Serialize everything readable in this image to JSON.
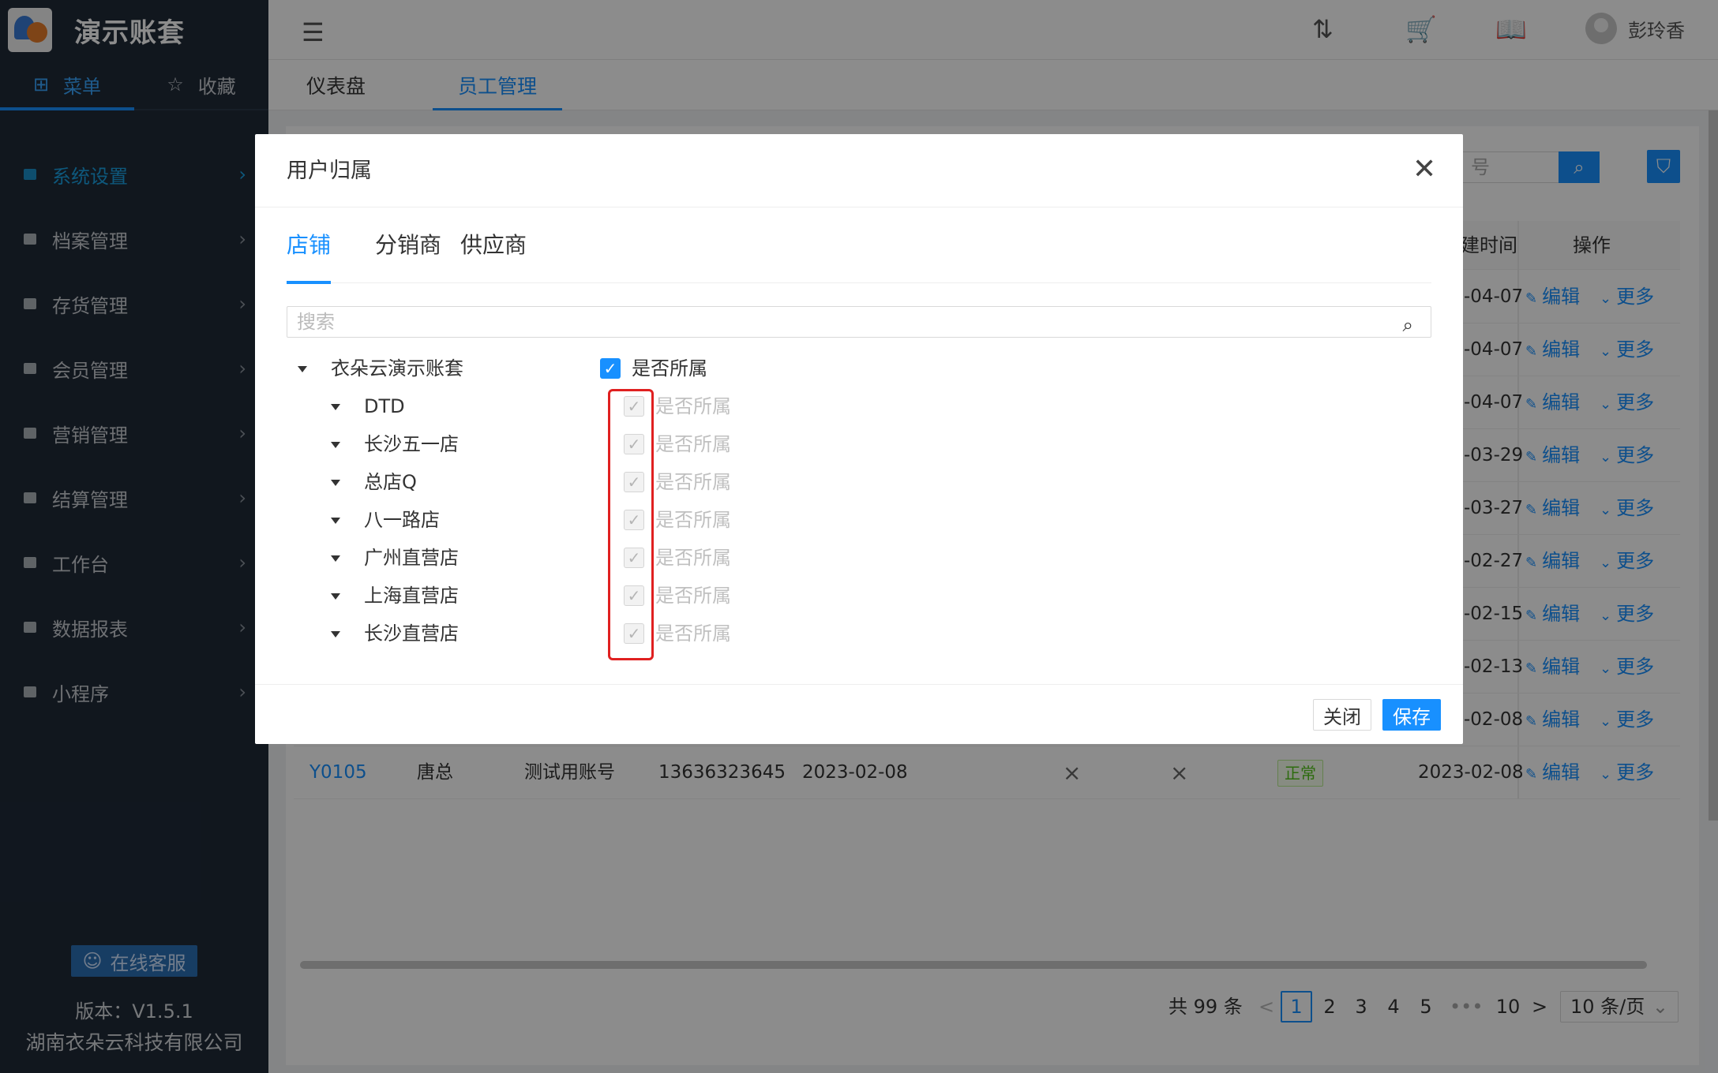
{
  "app": {
    "brand_title": "演示账套",
    "side_tabs": [
      {
        "label": "菜单",
        "icon": "grid-icon"
      },
      {
        "label": "收藏",
        "icon": "star-icon"
      }
    ],
    "menu": [
      {
        "label": "系统设置",
        "active": true
      },
      {
        "label": "档案管理"
      },
      {
        "label": "存货管理"
      },
      {
        "label": "会员管理"
      },
      {
        "label": "营销管理"
      },
      {
        "label": "结算管理"
      },
      {
        "label": "工作台"
      },
      {
        "label": "数据报表"
      },
      {
        "label": "小程序"
      }
    ],
    "support_label": "在线客服",
    "version": "版本：V1.5.1",
    "company": "湖南衣朵云科技有限公司"
  },
  "header": {
    "user_name": "彭玲香",
    "icons": [
      "menu-toggle-icon",
      "sort-az-icon",
      "cart-icon",
      "book-icon"
    ]
  },
  "page_tabs": [
    {
      "label": "仪表盘"
    },
    {
      "label": "员工管理",
      "active": true
    }
  ],
  "table": {
    "search_placeholder": "号",
    "headers": {
      "time": "建时间",
      "ops": "操作"
    },
    "row_dates": [
      "-04-07",
      "-04-07",
      "-04-07",
      "-03-29",
      "-03-27",
      "-02-27",
      "-02-15",
      "-02-13",
      "-02-08"
    ],
    "op_edit": "编辑",
    "op_more": "更多",
    "last_row": {
      "code": "Y0105",
      "name": "唐总",
      "desc": "测试用账号",
      "phone": "13636323645",
      "date": "2023-02-08",
      "mark1": "×",
      "mark2": "×",
      "status": "正常",
      "created": "2023-02-08"
    }
  },
  "pagination": {
    "total": "共 99 条",
    "pages": [
      "1",
      "2",
      "3",
      "4",
      "5",
      "•••",
      "10"
    ],
    "current": "1",
    "prev": "<",
    "next": ">",
    "page_size": "10 条/页"
  },
  "modal": {
    "title": "用户归属",
    "tabs": [
      {
        "label": "店铺",
        "active": true
      },
      {
        "label": "分销商"
      },
      {
        "label": "供应商"
      }
    ],
    "search_placeholder": "搜索",
    "root": {
      "label": "衣朵云演示账套",
      "check_label": "是否所属",
      "checked": true
    },
    "children": [
      {
        "label": "DTD",
        "check_label": "是否所属"
      },
      {
        "label": "长沙五一店",
        "check_label": "是否所属"
      },
      {
        "label": "总店Q",
        "check_label": "是否所属"
      },
      {
        "label": "八一路店",
        "check_label": "是否所属"
      },
      {
        "label": "广州直营店",
        "check_label": "是否所属"
      },
      {
        "label": "上海直营店",
        "check_label": "是否所属"
      },
      {
        "label": "长沙直营店",
        "check_label": "是否所属"
      }
    ],
    "close_label": "关闭",
    "save_label": "保存"
  },
  "colors": {
    "accent": "#1890ff",
    "sidebar_bg": "#1f2a38",
    "highlight": "#e02020"
  }
}
